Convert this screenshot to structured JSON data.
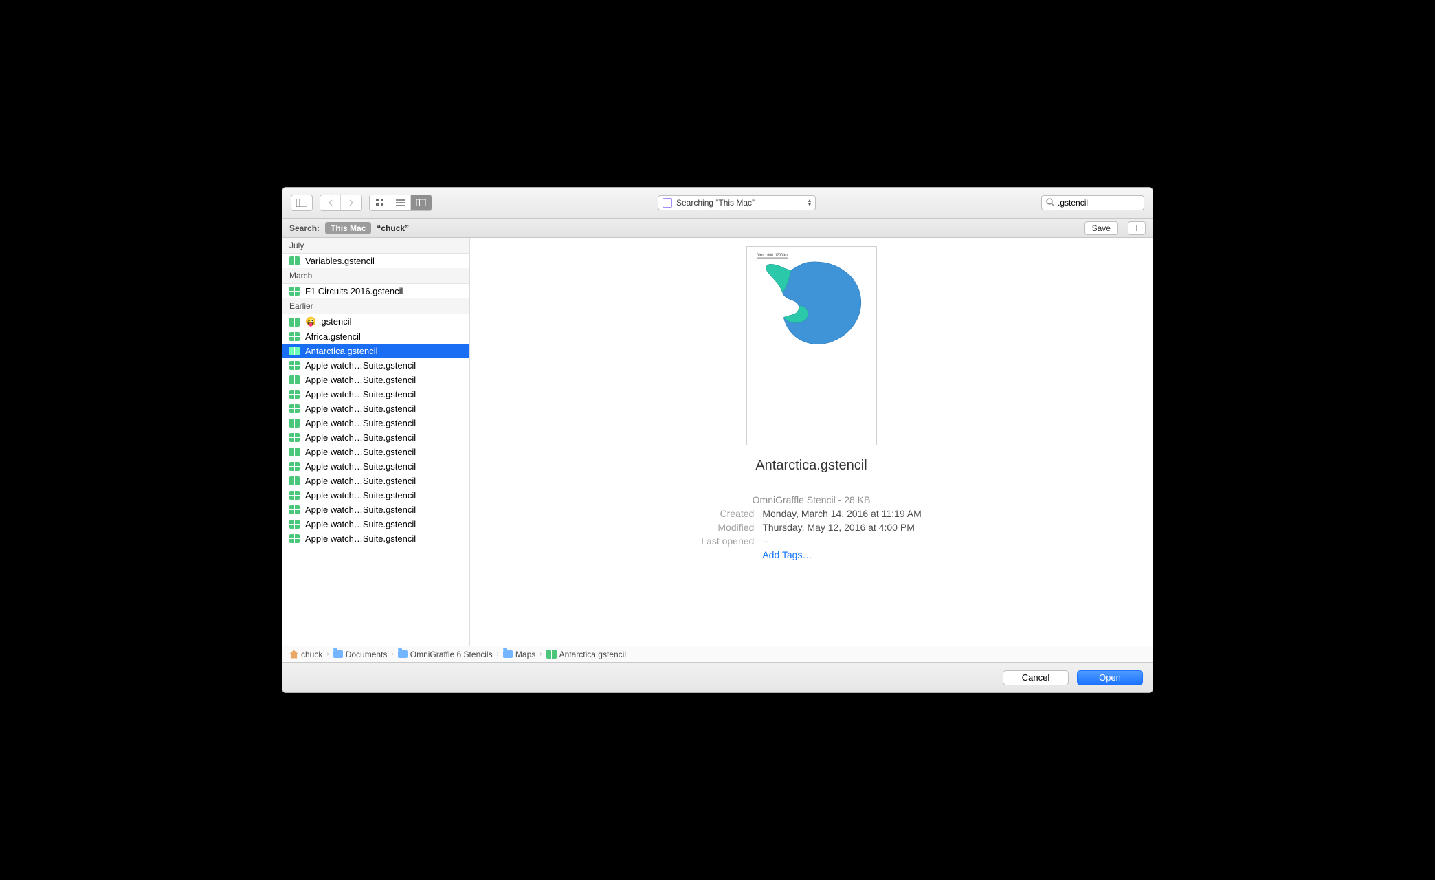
{
  "toolbar": {
    "location_label": "Searching “This Mac”"
  },
  "search": {
    "value": ".gstencil"
  },
  "scope": {
    "label": "Search:",
    "selected": "This Mac",
    "alt": "“chuck”",
    "save": "Save"
  },
  "groups": [
    {
      "label": "July",
      "files": [
        {
          "name": "Variables.gstencil",
          "selected": false
        }
      ]
    },
    {
      "label": "March",
      "files": [
        {
          "name": "F1 Circuits 2016.gstencil",
          "selected": false
        }
      ]
    },
    {
      "label": "Earlier",
      "files": [
        {
          "name": "😜 .gstencil",
          "selected": false
        },
        {
          "name": "Africa.gstencil",
          "selected": false
        },
        {
          "name": "Antarctica.gstencil",
          "selected": true
        },
        {
          "name": "Apple watch…Suite.gstencil",
          "selected": false
        },
        {
          "name": "Apple watch…Suite.gstencil",
          "selected": false
        },
        {
          "name": "Apple watch…Suite.gstencil",
          "selected": false
        },
        {
          "name": "Apple watch…Suite.gstencil",
          "selected": false
        },
        {
          "name": "Apple watch…Suite.gstencil",
          "selected": false
        },
        {
          "name": "Apple watch…Suite.gstencil",
          "selected": false
        },
        {
          "name": "Apple watch…Suite.gstencil",
          "selected": false
        },
        {
          "name": "Apple watch…Suite.gstencil",
          "selected": false
        },
        {
          "name": "Apple watch…Suite.gstencil",
          "selected": false
        },
        {
          "name": "Apple watch…Suite.gstencil",
          "selected": false
        },
        {
          "name": "Apple watch…Suite.gstencil",
          "selected": false
        },
        {
          "name": "Apple watch…Suite.gstencil",
          "selected": false
        },
        {
          "name": "Apple watch…Suite.gstencil",
          "selected": false
        }
      ]
    }
  ],
  "preview": {
    "title": "Antarctica.gstencil",
    "kind": "OmniGraffle Stencil - 28 KB",
    "created_label": "Created",
    "created_value": "Monday, March 14, 2016 at 11:19 AM",
    "modified_label": "Modified",
    "modified_value": "Thursday, May 12, 2016 at 4:00 PM",
    "opened_label": "Last opened",
    "opened_value": "--",
    "add_tags": "Add Tags…",
    "scale_labels": "0 km   600  1200 km"
  },
  "path": [
    {
      "icon": "home",
      "label": "chuck"
    },
    {
      "icon": "folder",
      "label": "Documents"
    },
    {
      "icon": "folder",
      "label": "OmniGraffle 6 Stencils"
    },
    {
      "icon": "folder",
      "label": "Maps"
    },
    {
      "icon": "stencil",
      "label": "Antarctica.gstencil"
    }
  ],
  "footer": {
    "cancel": "Cancel",
    "open": "Open"
  }
}
